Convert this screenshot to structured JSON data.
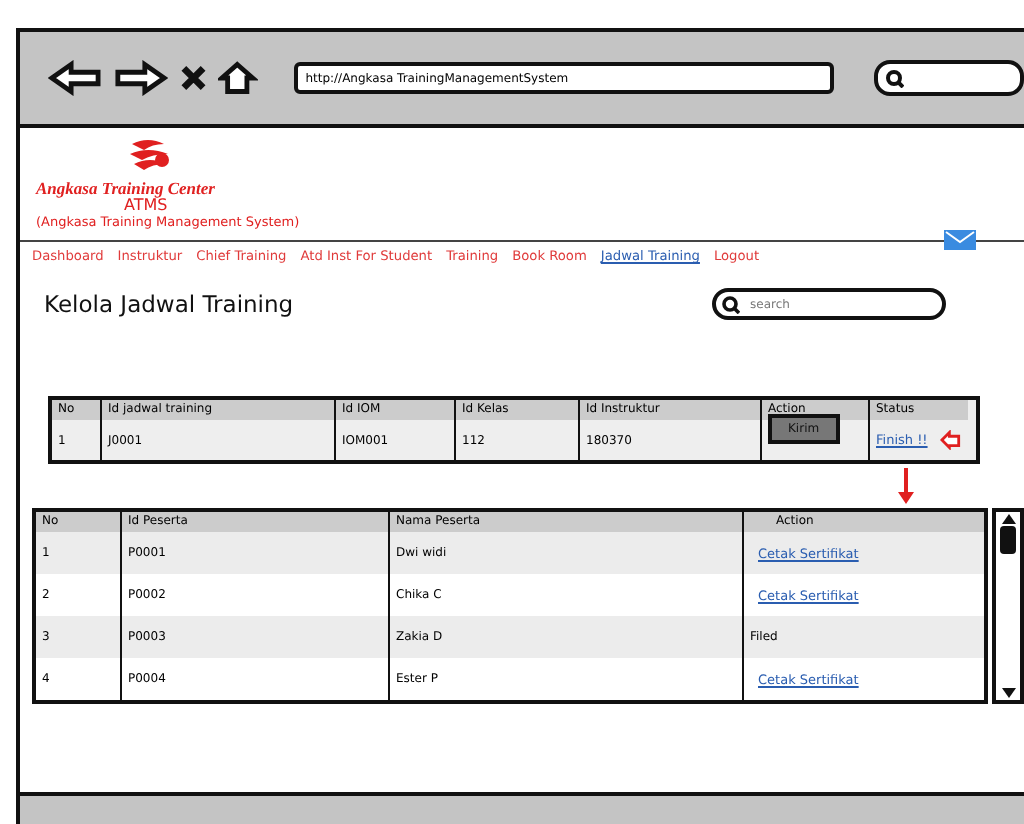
{
  "browser": {
    "url": "http://Angkasa TrainingManagementSystem"
  },
  "header": {
    "brand": "Angkasa Training Center",
    "app_name": "ATMS",
    "app_full_name": "(Angkasa Training Management System)"
  },
  "nav": [
    {
      "label": "Dashboard",
      "selected": false
    },
    {
      "label": "Instruktur",
      "selected": false
    },
    {
      "label": "Chief Training",
      "selected": false
    },
    {
      "label": "Atd Inst For Student",
      "selected": false
    },
    {
      "label": "Training",
      "selected": false
    },
    {
      "label": "Book Room",
      "selected": false
    },
    {
      "label": "Jadwal Training",
      "selected": true
    },
    {
      "label": "Logout",
      "selected": false
    }
  ],
  "page_title": "Kelola Jadwal Training",
  "search": {
    "placeholder": "search"
  },
  "schedule_table": {
    "columns": [
      "No",
      "Id jadwal training",
      "Id IOM",
      "Id Kelas",
      "Id Instruktur",
      "Action",
      "Status"
    ],
    "rows": [
      {
        "no": "1",
        "id_jadwal": "J0001",
        "id_iom": "IOM001",
        "id_kelas": "112",
        "id_instruktur": "180370",
        "action": "Kirim",
        "status": "Finish !!"
      }
    ]
  },
  "participant_table": {
    "columns": [
      "No",
      "Id Peserta",
      "Nama Peserta",
      "Action"
    ],
    "rows": [
      {
        "no": "1",
        "id": "P0001",
        "name": "Dwi widi",
        "action": {
          "kind": "link",
          "text": "Cetak Sertifikat"
        }
      },
      {
        "no": "2",
        "id": "P0002",
        "name": "Chika C",
        "action": {
          "kind": "link",
          "text": "Cetak Sertifikat"
        }
      },
      {
        "no": "3",
        "id": "P0003",
        "name": "Zakia D",
        "action": {
          "kind": "text",
          "text": "Filed"
        }
      },
      {
        "no": "4",
        "id": "P0004",
        "name": "Ester P",
        "action": {
          "kind": "link",
          "text": "Cetak Sertifikat"
        }
      }
    ]
  }
}
